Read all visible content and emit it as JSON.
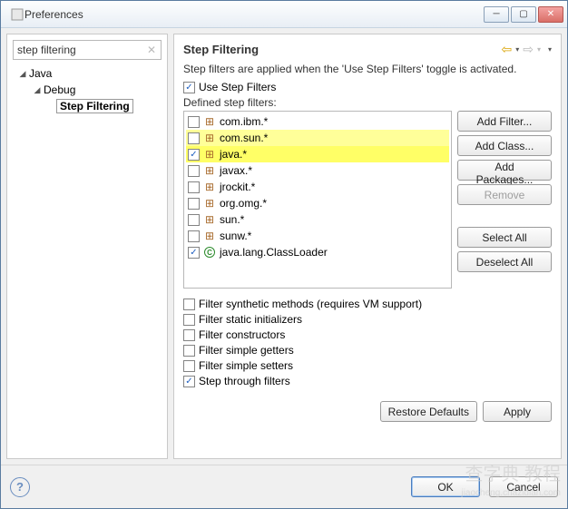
{
  "window": {
    "title": "Preferences"
  },
  "search": {
    "value": "step filtering"
  },
  "tree": {
    "node0": {
      "label": "Java"
    },
    "node1": {
      "label": "Debug"
    },
    "node2": {
      "label": "Step Filtering"
    }
  },
  "page": {
    "title": "Step Filtering",
    "description": "Step filters are applied when the 'Use Step Filters' toggle is activated.",
    "use_step_filters": "Use Step Filters",
    "defined_label": "Defined step filters:",
    "filters": [
      {
        "label": "com.ibm.*"
      },
      {
        "label": "com.sun.*"
      },
      {
        "label": "java.*"
      },
      {
        "label": "javax.*"
      },
      {
        "label": "jrockit.*"
      },
      {
        "label": "org.omg.*"
      },
      {
        "label": "sun.*"
      },
      {
        "label": "sunw.*"
      },
      {
        "label": "java.lang.ClassLoader"
      }
    ],
    "options": {
      "synthetic": "Filter synthetic methods (requires VM support)",
      "static_init": "Filter static initializers",
      "constructors": "Filter constructors",
      "getters": "Filter simple getters",
      "setters": "Filter simple setters",
      "step_through": "Step through filters"
    }
  },
  "buttons": {
    "add_filter": "Add Filter...",
    "add_class": "Add Class...",
    "add_packages": "Add Packages...",
    "remove": "Remove",
    "select_all": "Select All",
    "deselect_all": "Deselect All",
    "restore_defaults": "Restore Defaults",
    "apply": "Apply",
    "ok": "OK",
    "cancel": "Cancel"
  },
  "watermark": {
    "main": "查字典  教程",
    "sub": "jiaocheng.chazidian.com"
  }
}
